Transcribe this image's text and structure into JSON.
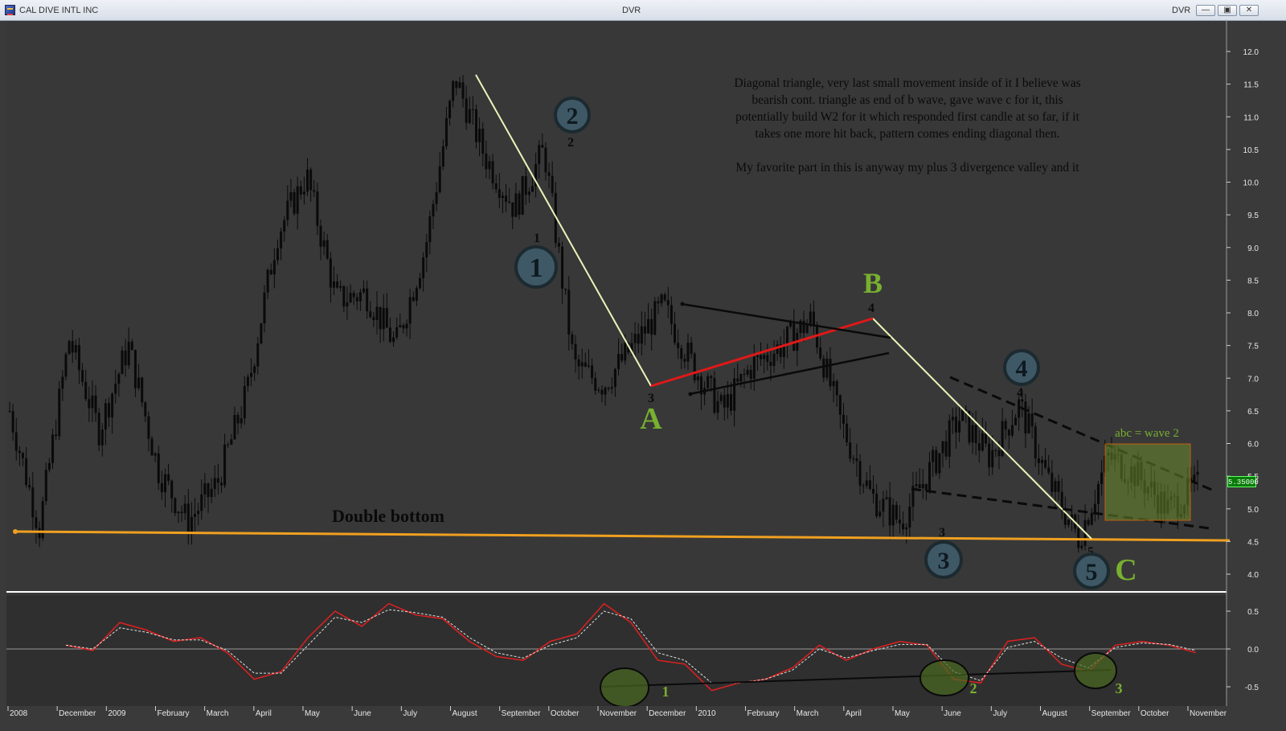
{
  "window": {
    "title": "CAL DIVE INTL INC",
    "symbol": "DVR",
    "symbol_right": "DVR",
    "buttons": [
      "minimize",
      "restore",
      "close"
    ]
  },
  "price_label": "5.35000",
  "annotation": {
    "lines": [
      "Diagonal triangle, very last small movement inside of it I believe was",
      "bearish cont. triangle as end of b wave, gave wave c for it, this",
      "potentially build W2 for it which responded first candle at so far, if it",
      "takes one more hit back, pattern comes ending diagonal then.",
      "",
      "My favorite part in this is anyway my plus 3 divergence valley and it"
    ]
  },
  "labels": {
    "double_bottom": "Double bottom",
    "abc_wave": "abc = wave 2",
    "wave_a": "A",
    "wave_b": "B",
    "wave_c": "C"
  },
  "circled_waves": [
    {
      "text": "1",
      "small": "1"
    },
    {
      "text": "2",
      "small": "2"
    },
    {
      "text": "3",
      "small": "3"
    },
    {
      "text": "4",
      "small": "4"
    },
    {
      "text": "5",
      "small": "5"
    }
  ],
  "small_wave_numbers": {
    "a": "3",
    "b": "4"
  },
  "divergence_labels": [
    "1",
    "2",
    "3"
  ],
  "colors": {
    "background": "#3a3a3a",
    "candles": "#0a0a0a",
    "support_line": "#f0a020",
    "red_line": "#e01818",
    "green_text": "#78b030",
    "impulse_line": "#e8f5b8",
    "macd_line": "#e02020",
    "signal_line": "#e0e0e0",
    "circle_fill": "#3e5866"
  },
  "chart_data": [
    {
      "type": "candlestick",
      "title": "",
      "y_ticks": [
        "12.0",
        "11.5",
        "11.0",
        "10.5",
        "10.0",
        "9.5",
        "9.0",
        "8.5",
        "8.0",
        "7.5",
        "7.0",
        "6.5",
        "6.0",
        "5.5",
        "5.0",
        "4.5",
        "4.0"
      ],
      "x_ticks": [
        "2008",
        "December",
        "2009",
        "February",
        "March",
        "April",
        "May",
        "June",
        "July",
        "August",
        "September",
        "October",
        "November",
        "December",
        "2010",
        "February",
        "March",
        "April",
        "May",
        "June",
        "July",
        "August",
        "September",
        "October",
        "November"
      ],
      "ylim": [
        3.6,
        12.2
      ],
      "last_price": 5.35,
      "approx_price_path": [
        [
          "2008-11",
          6.5
        ],
        [
          "2008-11",
          4.7
        ],
        [
          "2008-12",
          7.6
        ],
        [
          "2009-01",
          6.2
        ],
        [
          "2009-01",
          7.5
        ],
        [
          "2009-02",
          5.6
        ],
        [
          "2009-03",
          4.8
        ],
        [
          "2009-03",
          5.4
        ],
        [
          "2009-04",
          6.8
        ],
        [
          "2009-05",
          9.2
        ],
        [
          "2009-05",
          10.1
        ],
        [
          "2009-06",
          8.2
        ],
        [
          "2009-07",
          8.3
        ],
        [
          "2009-07",
          7.5
        ],
        [
          "2009-08",
          9.0
        ],
        [
          "2009-09",
          11.6
        ],
        [
          "2009-09",
          10.4
        ],
        [
          "2009-10",
          9.6
        ],
        [
          "2009-10",
          10.5
        ],
        [
          "2009-11",
          7.2
        ],
        [
          "2009-12",
          6.9
        ],
        [
          "2009-12",
          7.5
        ],
        [
          "2010-01",
          8.1
        ],
        [
          "2010-02",
          7.2
        ],
        [
          "2010-02",
          6.5
        ],
        [
          "2010-03",
          7.2
        ],
        [
          "2010-04",
          7.5
        ],
        [
          "2010-04",
          7.9
        ],
        [
          "2010-05",
          6.3
        ],
        [
          "2010-05",
          5.2
        ],
        [
          "2010-06",
          4.8
        ],
        [
          "2010-06",
          5.6
        ],
        [
          "2010-07",
          6.4
        ],
        [
          "2010-07",
          5.8
        ],
        [
          "2010-08",
          6.6
        ],
        [
          "2010-08",
          5.4
        ],
        [
          "2010-09",
          4.55
        ],
        [
          "2010-09",
          5.8
        ],
        [
          "2010-10",
          5.5
        ],
        [
          "2010-11",
          5.0
        ],
        [
          "2010-11",
          5.35
        ]
      ]
    },
    {
      "type": "line",
      "title": "",
      "y_ticks": [
        "0.5",
        "0.0",
        "-0.5"
      ],
      "ylim": [
        -0.85,
        0.75
      ],
      "series": [
        {
          "values": [
            0.05,
            -0.02,
            0.35,
            0.25,
            0.1,
            0.15,
            -0.05,
            -0.4,
            -0.3,
            0.15,
            0.5,
            0.3,
            0.6,
            0.45,
            0.4,
            0.1,
            -0.1,
            -0.15,
            0.1,
            0.2,
            0.6,
            0.35,
            -0.15,
            -0.2,
            -0.55,
            -0.45,
            -0.4,
            -0.25,
            0.05,
            -0.15,
            0.0,
            0.1,
            0.05,
            -0.4,
            -0.45,
            0.1,
            0.15,
            -0.2,
            -0.3,
            0.05,
            0.1,
            0.05,
            -0.05
          ]
        },
        {
          "values": [
            0.05,
            0.0,
            0.28,
            0.22,
            0.12,
            0.12,
            -0.02,
            -0.32,
            -0.32,
            0.05,
            0.42,
            0.35,
            0.52,
            0.48,
            0.42,
            0.15,
            -0.05,
            -0.12,
            0.05,
            0.15,
            0.5,
            0.4,
            -0.05,
            -0.15,
            -0.45,
            -0.45,
            -0.4,
            -0.28,
            0.0,
            -0.12,
            -0.02,
            0.06,
            0.06,
            -0.3,
            -0.42,
            0.02,
            0.1,
            -0.12,
            -0.25,
            0.02,
            0.08,
            0.06,
            -0.02
          ]
        }
      ]
    }
  ]
}
